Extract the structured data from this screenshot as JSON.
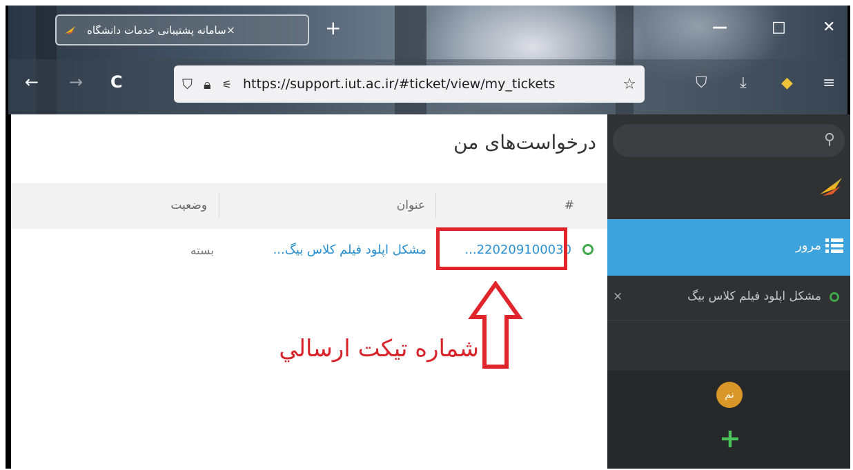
{
  "browser": {
    "tab_title": "سامانه پشتیبانی خدمات دانشگاه",
    "tab_close": "×",
    "new_tab": "+",
    "url": "https://support.iut.ac.ir/#ticket/view/my_tickets",
    "minimize": "—",
    "maximize": "□",
    "close": "✕",
    "back": "←",
    "forward": "→",
    "reload": "C"
  },
  "page": {
    "title": "درخواست‌های من",
    "columns": [
      "#",
      "عنوان",
      "وضعیت"
    ],
    "tickets": [
      {
        "id": "...220209100030",
        "title": "مشکل اپلود فیلم کلاس بیگ...",
        "state": "بسته"
      }
    ]
  },
  "annotation": {
    "text": "شماره تیکت ارسالي",
    "color": "#d8252b"
  },
  "sidebar": {
    "search_icon": "search-icon",
    "nav_label": "مرور",
    "open_ticket": "مشکل اپلود فیلم کلاس بیگ",
    "open_ticket_close": "×",
    "avatar_initials": "نم",
    "add": "+"
  },
  "colors": {
    "accent": "#3ea3dc",
    "status_ok": "#3fa84a",
    "link": "#2a8fd0",
    "avatar": "#d9972a"
  }
}
